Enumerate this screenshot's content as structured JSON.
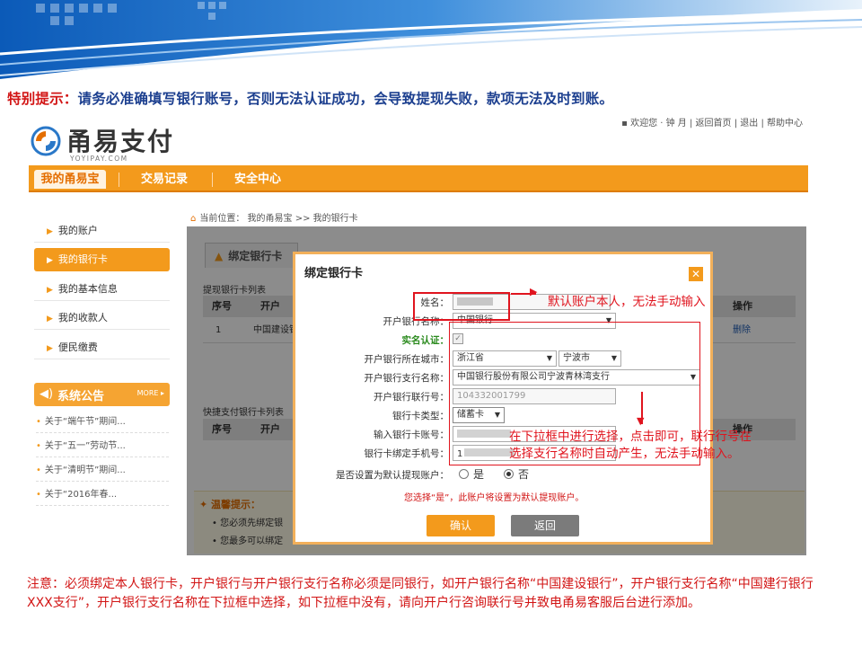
{
  "warning": {
    "prefix": "特别提示：",
    "text": "请务必准确填写银行账号，否则无法认证成功，会导致提现失败，款项无法及时到账。"
  },
  "header": {
    "logo_text": "甬易支付",
    "logo_sub": "YOYIPAY.COM",
    "top_links": "▪ 欢迎您 · 钟  月  |  返回首页  |  退出  |  帮助中心"
  },
  "nav": {
    "tabs": [
      "我的甬易宝",
      "交易记录",
      "安全中心"
    ]
  },
  "sidebar": {
    "items": [
      "我的账户",
      "我的银行卡",
      "我的基本信息",
      "我的收款人",
      "便民缴费"
    ],
    "notice_title": "系统公告",
    "notice_more": "MORE ▸",
    "notices": [
      "关于“端午节”期间...",
      "关于“五一”劳动节...",
      "关于“清明节”期间...",
      "关于“2016年春..."
    ]
  },
  "content": {
    "breadcrumb": "当前位置：  我的甬易宝   >>  我的银行卡",
    "bind_tab": "绑定银行卡",
    "withdraw_list_title": "提现银行卡列表",
    "withdraw_headers": [
      "序号",
      "开户",
      "操作"
    ],
    "withdraw_row": [
      "1",
      "中国建设银",
      "删除"
    ],
    "quick_list_title": "快捷支付银行卡列表",
    "quick_headers": [
      "序号",
      "开户",
      "操作"
    ],
    "tips_title": "温馨提示：",
    "tips": [
      "您必须先绑定银",
      "您最多可以绑定"
    ]
  },
  "dialog": {
    "title": "绑定银行卡",
    "close": "✕",
    "fields": {
      "name_label": "姓名：",
      "bank_label": "开户银行名称：",
      "bank_value": "中国银行",
      "verify_label": "实名认证：",
      "city_label": "开户银行所在城市：",
      "province_value": "浙江省",
      "city_value": "宁波市",
      "branch_label": "开户银行支行名称：",
      "branch_value": "中国银行股份有限公司宁波青林湾支行",
      "code_label": "开户银行联行号：",
      "code_value": "104332001799",
      "card_type_label": "银行卡类型：",
      "card_type_value": "储蓄卡",
      "card_no_label": "输入银行卡账号：",
      "card_no_value": "",
      "phone_label": "银行卡绑定手机号：",
      "phone_value": "1",
      "default_label": "是否设置为默认提现账户：",
      "opt_yes": "是",
      "opt_no": "否"
    },
    "hint": "您选择“是”，此账户将设置为默认提现账户。",
    "ok_button": "确认",
    "back_button": "返回"
  },
  "annotations": {
    "name_note": "默认账户本人，无法手动输入",
    "select_note_1": "在下拉框中进行选择，点击即可，联行行号在",
    "select_note_2": "选择支行名称时自动产生，无法手动输入。"
  },
  "footnote": "注意：必须绑定本人银行卡，开户银行与开户银行支行名称必须是同银行，如开户银行名称“中国建设银行”，开户银行支行名称“中国建行银行XXX支行”，开户银行支行名称在下拉框中选择，如下拉框中没有，请向开户行咨询联行号并致电甬易客服后台进行添加。",
  "colors": {
    "accent": "#f39a1c",
    "annotation": "#e0141e",
    "title_blue": "#1c3f8f"
  }
}
